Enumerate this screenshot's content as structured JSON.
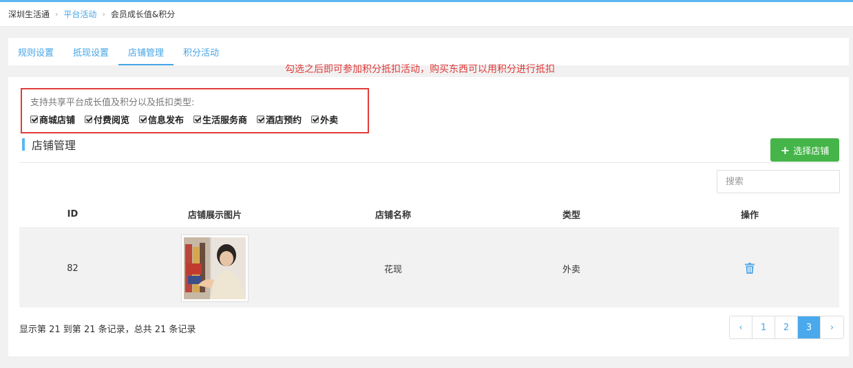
{
  "breadcrumb": {
    "items": [
      "深圳生活通",
      "平台活动",
      "会员成长值&积分"
    ]
  },
  "tabs": [
    {
      "label": "规则设置",
      "active": false
    },
    {
      "label": "抵现设置",
      "active": false
    },
    {
      "label": "店铺管理",
      "active": true
    },
    {
      "label": "积分活动",
      "active": false
    }
  ],
  "annotation": "勾选之后即可参加积分抵扣活动，购买东西可以用积分进行抵扣",
  "types": {
    "title": "支持共享平台成长值及积分以及抵扣类型:",
    "items": [
      {
        "label": "商城店铺",
        "checked": true
      },
      {
        "label": "付费阅览",
        "checked": true
      },
      {
        "label": "信息发布",
        "checked": true
      },
      {
        "label": "生活服务商",
        "checked": true
      },
      {
        "label": "酒店预约",
        "checked": true
      },
      {
        "label": "外卖",
        "checked": true
      }
    ]
  },
  "section": {
    "title": "店铺管理",
    "select_label": "选择店铺"
  },
  "search": {
    "placeholder": "搜索",
    "value": ""
  },
  "table": {
    "headers": [
      "ID",
      "店铺展示图片",
      "店铺名称",
      "类型",
      "操作"
    ],
    "rows": [
      {
        "id": "82",
        "name": "花现",
        "type": "外卖"
      }
    ]
  },
  "footer": {
    "record_info": "显示第 21 到第 21 条记录，总共 21 条记录"
  },
  "pagination": {
    "prev": "‹",
    "pages": [
      "1",
      "2",
      "3"
    ],
    "current": "3",
    "next": "›"
  },
  "colors": {
    "accent": "#45a5e6",
    "green": "#45b549",
    "annotation": "#e03a3a"
  }
}
